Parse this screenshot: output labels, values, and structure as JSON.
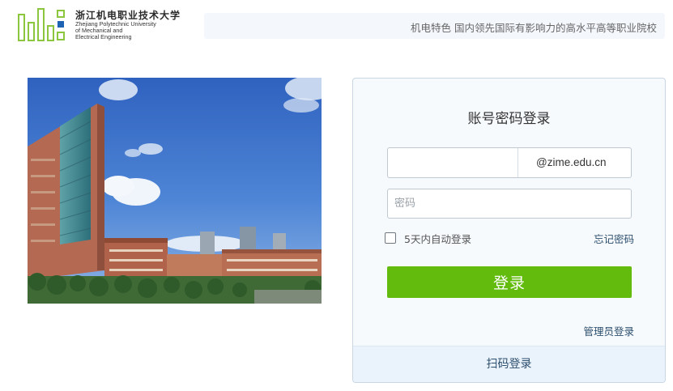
{
  "header": {
    "logo": {
      "cn_name": "浙江机电职业技术大学",
      "en_lines": [
        "Zhejiang Polytechnic University",
        "of Mechanical and",
        "Electrical Engineering"
      ]
    },
    "slogan": "机电特色  国内领先国际有影响力的高水平高等职业院校"
  },
  "login": {
    "title": "账号密码登录",
    "account": {
      "value": "",
      "placeholder": "",
      "suffix": "@zime.edu.cn"
    },
    "password": {
      "value": "",
      "placeholder": "密码"
    },
    "remember_label": "5天内自动登录",
    "remember_checked": false,
    "forgot_label": "忘记密码",
    "submit_label": "登录",
    "admin_label": "管理员登录",
    "qr_label": "扫码登录"
  },
  "colors": {
    "brand_green": "#62bb0d",
    "logo_green": "#8cc63f",
    "logo_blue": "#1e63b3",
    "link": "#2c4f6e"
  },
  "icons": [
    "university-logo-icon"
  ]
}
